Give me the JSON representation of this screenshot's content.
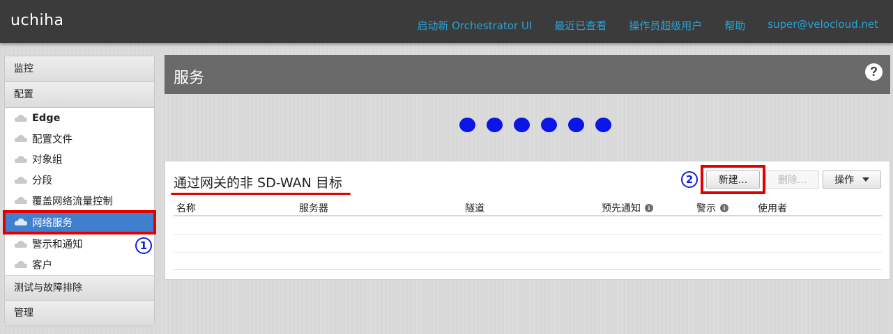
{
  "header": {
    "brand": "uchiha",
    "nav": [
      "启动新 Orchestrator UI",
      "最近已查看",
      "操作员超级用户",
      "帮助",
      "super@velocloud.net"
    ]
  },
  "sidebar": {
    "sections": {
      "monitor": "监控",
      "configure": "配置",
      "test": "测试与故障排除",
      "admin": "管理"
    },
    "items": [
      {
        "label": "Edge"
      },
      {
        "label": "配置文件"
      },
      {
        "label": "对象组"
      },
      {
        "label": "分段"
      },
      {
        "label": "覆盖网络流量控制"
      },
      {
        "label": "网络服务"
      },
      {
        "label": "警示和通知"
      },
      {
        "label": "客户"
      }
    ],
    "marker": "1"
  },
  "main": {
    "title": "服务",
    "help_icon": "?",
    "loading_dots": 6
  },
  "panel": {
    "title_prefix": "通过网关的非 ",
    "title_strong": "SD-WAN",
    "title_suffix": " 目标",
    "marker": "2",
    "buttons": {
      "new": "新建...",
      "delete": "删除...",
      "actions": "操作"
    },
    "columns": [
      "名称",
      "服务器",
      "隧道",
      "预先通知",
      "警示",
      "使用者"
    ],
    "info_icon": "i"
  },
  "colors": {
    "topbar": "#3b3b3b",
    "link": "#29a3d6",
    "active": "#3f7fce",
    "highlight": "#e40000",
    "marker": "#1020d8",
    "dot": "#0a16e6"
  }
}
